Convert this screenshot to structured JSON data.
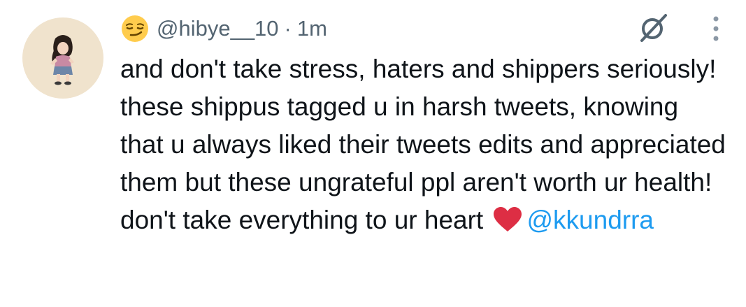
{
  "tweet": {
    "handle": "@hibye__10",
    "separator": "·",
    "timestamp": "1m",
    "text": "and don't take stress, haters and shippers seriously! these shippus tagged u in harsh tweets, knowing that u always liked their tweets edits and appreciated them but these ungrateful ppl aren't worth ur health! don't take everything to ur heart ",
    "mention": "@kkundrra",
    "icons": {
      "name_emoji": "smirking-face-emoji",
      "heart_emoji": "red-heart-emoji",
      "grok": "grok-icon",
      "more": "more-vertical-icon"
    },
    "colors": {
      "text": "#0f1419",
      "secondary": "#536471",
      "link": "#1d9bf0",
      "avatar_bg": "#f0e3cd"
    }
  }
}
